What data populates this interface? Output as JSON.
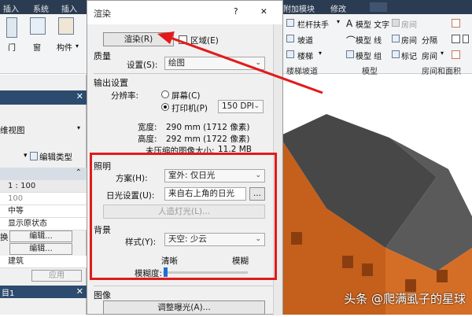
{
  "ribbon": {
    "tabs": [
      "插入",
      "系统",
      "插入"
    ],
    "tab_modify": "修改",
    "tab_addins": "附加模块",
    "buttons": {
      "door": "门",
      "window": "窗",
      "component": "构件",
      "railing": "栏杆扶手",
      "ramp": "坡道",
      "stair": "楼梯",
      "model_text": "模型 文字",
      "model_line": "模型 线",
      "model_group": "模型 组",
      "room": "房间",
      "room_sep": "房间",
      "area": "分隔",
      "tag": "标记",
      "room2": "房间"
    },
    "groups": {
      "stair_ramp": "楼梯坡道",
      "model": "模型",
      "room_area": "房间和面积"
    }
  },
  "left_panel": {
    "properties_label": "维视图",
    "edit_type": "编辑类型",
    "rows": [
      "1 : 100",
      "100",
      "中等",
      "显示原状态",
      "编辑...",
      "编辑...",
      "建筑"
    ],
    "left_cut": [
      "换"
    ],
    "apply": "应用",
    "bottom": "目1"
  },
  "dialog": {
    "title": "渲染",
    "help": "?",
    "close": "✕",
    "render_button": "渲染(R)",
    "region_label": "区域(E)",
    "quality_section": "质量",
    "setting_label": "设置(S):",
    "setting_value": "绘图",
    "output_section": "输出设置",
    "resolution_label": "分辨率:",
    "screen_label": "屏幕(C)",
    "printer_label": "打印机(P)",
    "dpi_value": "150 DPI",
    "width_label": "宽度:",
    "width_value": "290 mm (1712 像素)",
    "height_label": "高度:",
    "height_value": "292 mm (1722 像素)",
    "size_label": "未压缩的图像大小:",
    "size_value": "11.2 MB",
    "lighting_section": "照明",
    "scheme_label": "方案(H):",
    "scheme_value": "室外: 仅日光",
    "sun_label": "日光设置(U):",
    "sun_value": "来自右上角的日光",
    "sun_dots": "...",
    "artificial_button": "人造灯光(L)...",
    "background_section": "背景",
    "style_label": "样式(Y):",
    "style_value": "天空: 少云",
    "clear_label": "清晰",
    "blur_label": "模糊",
    "blur_degree_label": "模糊度:",
    "image_section": "图像",
    "exposure_button": "调整曝光(A)..."
  },
  "watermark": "头条 @爬满虱子的星球",
  "colors": {
    "highlight": "#e21a1a",
    "roof": "#4d4d4d",
    "wall": "#d2691e"
  }
}
